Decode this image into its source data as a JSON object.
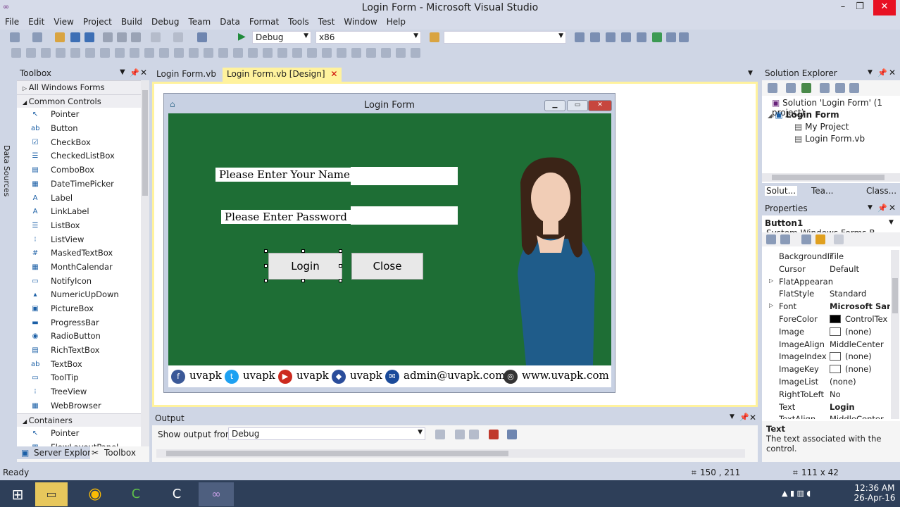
{
  "window": {
    "title": "Login Form - Microsoft Visual Studio",
    "minimize": "–",
    "restore": "❐",
    "close": "✕"
  },
  "menu": [
    "File",
    "Edit",
    "View",
    "Project",
    "Build",
    "Debug",
    "Team",
    "Data",
    "Format",
    "Tools",
    "Test",
    "Window",
    "Help"
  ],
  "toolbar": {
    "config": "Debug",
    "platform": "x86",
    "find": ""
  },
  "side_strip": {
    "data_sources": "Data Sources"
  },
  "toolbox": {
    "title": "Toolbox",
    "all_forms": "All Windows Forms",
    "common_controls": "Common Controls",
    "items": [
      {
        "icon": "↖",
        "label": "Pointer"
      },
      {
        "icon": "ab",
        "label": "Button"
      },
      {
        "icon": "☑",
        "label": "CheckBox"
      },
      {
        "icon": "☰",
        "label": "CheckedListBox"
      },
      {
        "icon": "▤",
        "label": "ComboBox"
      },
      {
        "icon": "▦",
        "label": "DateTimePicker"
      },
      {
        "icon": "A",
        "label": "Label"
      },
      {
        "icon": "A",
        "label": "LinkLabel"
      },
      {
        "icon": "☰",
        "label": "ListBox"
      },
      {
        "icon": "⁝",
        "label": "ListView"
      },
      {
        "icon": "#",
        "label": "MaskedTextBox"
      },
      {
        "icon": "▦",
        "label": "MonthCalendar"
      },
      {
        "icon": "▭",
        "label": "NotifyIcon"
      },
      {
        "icon": "▴",
        "label": "NumericUpDown"
      },
      {
        "icon": "▣",
        "label": "PictureBox"
      },
      {
        "icon": "▬",
        "label": "ProgressBar"
      },
      {
        "icon": "◉",
        "label": "RadioButton"
      },
      {
        "icon": "▤",
        "label": "RichTextBox"
      },
      {
        "icon": "ab",
        "label": "TextBox"
      },
      {
        "icon": "▭",
        "label": "ToolTip"
      },
      {
        "icon": "⁝",
        "label": "TreeView"
      },
      {
        "icon": "▦",
        "label": "WebBrowser"
      }
    ],
    "containers": "Containers",
    "container_items": [
      {
        "icon": "↖",
        "label": "Pointer"
      },
      {
        "icon": "▦",
        "label": "FlowLayoutPanel"
      }
    ],
    "bottom_tabs": [
      "Server Explorer",
      "Toolbox"
    ]
  },
  "doc_tabs": [
    {
      "label": "Login Form.vb",
      "active": false
    },
    {
      "label": "Login Form.vb [Design]",
      "active": true
    }
  ],
  "form": {
    "title": "Login Form",
    "name_label": "Please Enter Your Name",
    "password_label": "Please Enter Password",
    "login_button": "Login",
    "close_button": "Close",
    "footer": [
      {
        "icon": "f",
        "text": "uvapk",
        "color": "#3b5998"
      },
      {
        "icon": "t",
        "text": "uvapk",
        "color": "#1da1f2"
      },
      {
        "icon": "▶",
        "text": "uvapk",
        "color": "#cc2a1f"
      },
      {
        "icon": "◆",
        "text": "uvapk",
        "color": "#2a4d9b"
      },
      {
        "icon": "✉",
        "text": "admin@uvapk.com",
        "color": "#1a4a9a"
      },
      {
        "icon": "◎",
        "text": "www.uvapk.com",
        "color": "#333333"
      }
    ]
  },
  "output": {
    "title": "Output",
    "show_from_label": "Show output from:",
    "source": "Debug"
  },
  "solution_explorer": {
    "title": "Solution Explorer",
    "solution": "Solution 'Login Form' (1 project)",
    "project": "Login Form",
    "items": [
      "My Project",
      "Login Form.vb"
    ],
    "tabs": [
      "Solut...",
      "Tea...",
      "Class..."
    ]
  },
  "properties": {
    "title": "Properties",
    "object": "Button1",
    "object_type": "System.Windows.Forms.B",
    "rows": [
      {
        "name": "BackgroundIr",
        "value": "Tile"
      },
      {
        "name": "Cursor",
        "value": "Default"
      },
      {
        "name": "FlatAppearan",
        "value": ""
      },
      {
        "name": "FlatStyle",
        "value": "Standard"
      },
      {
        "name": "Font",
        "value": "Microsoft Sans"
      },
      {
        "name": "ForeColor",
        "value": "ControlTex"
      },
      {
        "name": "Image",
        "value": "(none)"
      },
      {
        "name": "ImageAlign",
        "value": "MiddleCenter"
      },
      {
        "name": "ImageIndex",
        "value": "(none)"
      },
      {
        "name": "ImageKey",
        "value": "(none)"
      },
      {
        "name": "ImageList",
        "value": "(none)"
      },
      {
        "name": "RightToLeft",
        "value": "No"
      },
      {
        "name": "Text",
        "value": "Login"
      },
      {
        "name": "TextAlign",
        "value": "MiddleCenter"
      }
    ],
    "desc_title": "Text",
    "desc_text": "The text associated with the control."
  },
  "status": {
    "ready": "Ready",
    "position": "150 , 211",
    "size": "111 x 42"
  },
  "taskbar": {
    "time": "12:36 AM",
    "date": "26-Apr-16"
  }
}
